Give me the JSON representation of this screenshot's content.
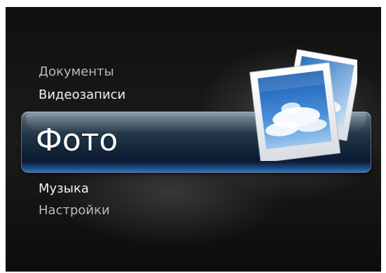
{
  "menu": {
    "items": [
      {
        "label": "Документы"
      },
      {
        "label": "Видеозаписи"
      },
      {
        "label": "Фото"
      },
      {
        "label": "Музыка"
      },
      {
        "label": "Настройки"
      }
    ],
    "selected_index": 2
  },
  "icons": {
    "selected_item_icon": "photos-icon"
  },
  "colors": {
    "background": "#141414",
    "highlight_bar": "#13253a",
    "highlight_bar_glow": "#2f77c4",
    "text_dim": "#b9b9b9",
    "text_bright": "#f2f2f2"
  }
}
